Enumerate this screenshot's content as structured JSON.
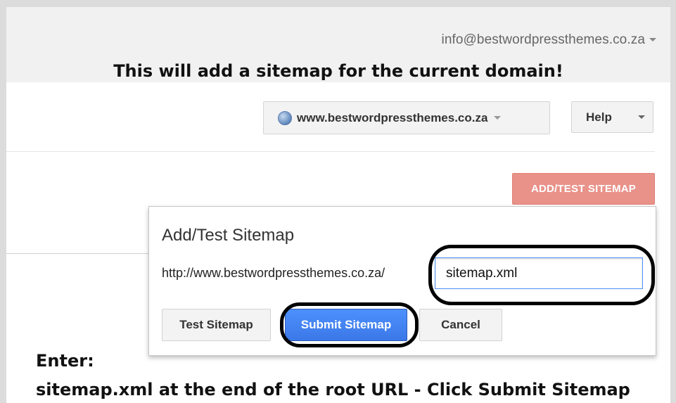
{
  "header": {
    "account_email": "info@bestwordpressthemes.co.za",
    "annotation_headline": "This will add a sitemap for the current domain!"
  },
  "toolbar": {
    "site_selector_label": "www.bestwordpressthemes.co.za",
    "help_label": "Help",
    "add_test_label": "ADD/TEST SITEMAP"
  },
  "dialog": {
    "title": "Add/Test Sitemap",
    "url_prefix": "http://www.bestwordpressthemes.co.za/",
    "path_value": "sitemap.xml",
    "test_label": "Test Sitemap",
    "submit_label": "Submit Sitemap",
    "cancel_label": "Cancel"
  },
  "annotations": {
    "instruction_line1": "Enter:",
    "instruction_line2": "sitemap.xml at the end of the root URL - Click Submit Sitemap"
  },
  "colors": {
    "add_test_button": "#e9928a",
    "submit_button": "#4d90fe",
    "input_focus_border": "#4d90fe"
  },
  "icons": {
    "site_selector": "globe-icon",
    "dropdowns": "chevron-down-icon"
  }
}
